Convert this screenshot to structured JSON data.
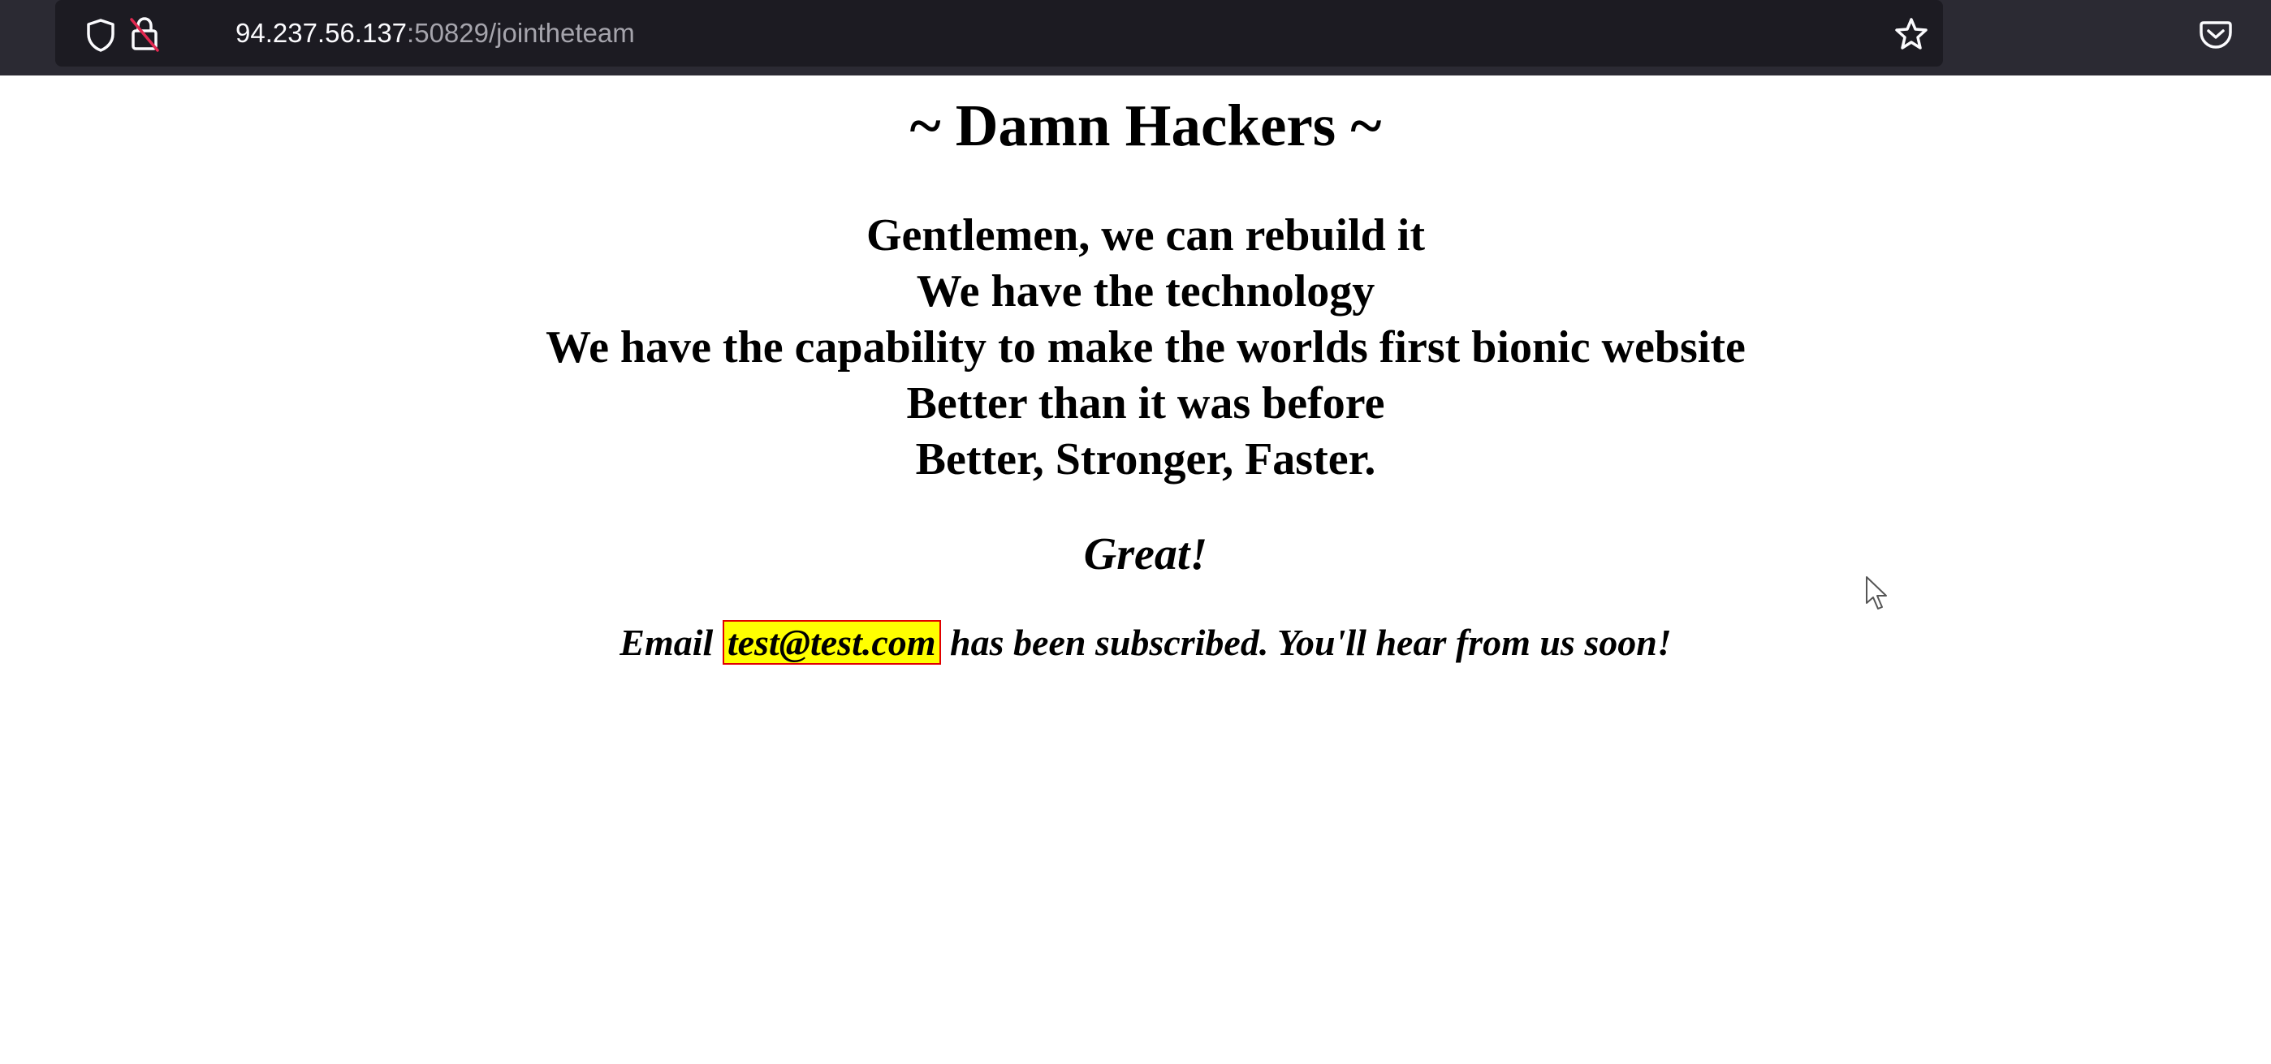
{
  "browser": {
    "url_host": "94.237.56.137",
    "url_rest": ":50829/jointheteam",
    "icons": [
      "shield-icon",
      "insecure-lock-icon",
      "bookmark-star-icon",
      "pocket-icon"
    ]
  },
  "page": {
    "title": "~ Damn Hackers ~",
    "lyrics": [
      "Gentlemen, we can rebuild it",
      "We have the technology",
      "We have the capability to make the worlds first bionic website",
      "Better than it was before",
      "Better, Stronger, Faster."
    ],
    "great": "Great!",
    "message_prefix": "Email",
    "email": "test@test.com",
    "message_suffix": "has been subscribed. You'll hear from us soon!"
  },
  "colors": {
    "toolbar_bg": "#2b2a33",
    "urlbar_bg": "#1c1b22",
    "email_highlight": "#ffff00",
    "email_border": "#e00000"
  }
}
